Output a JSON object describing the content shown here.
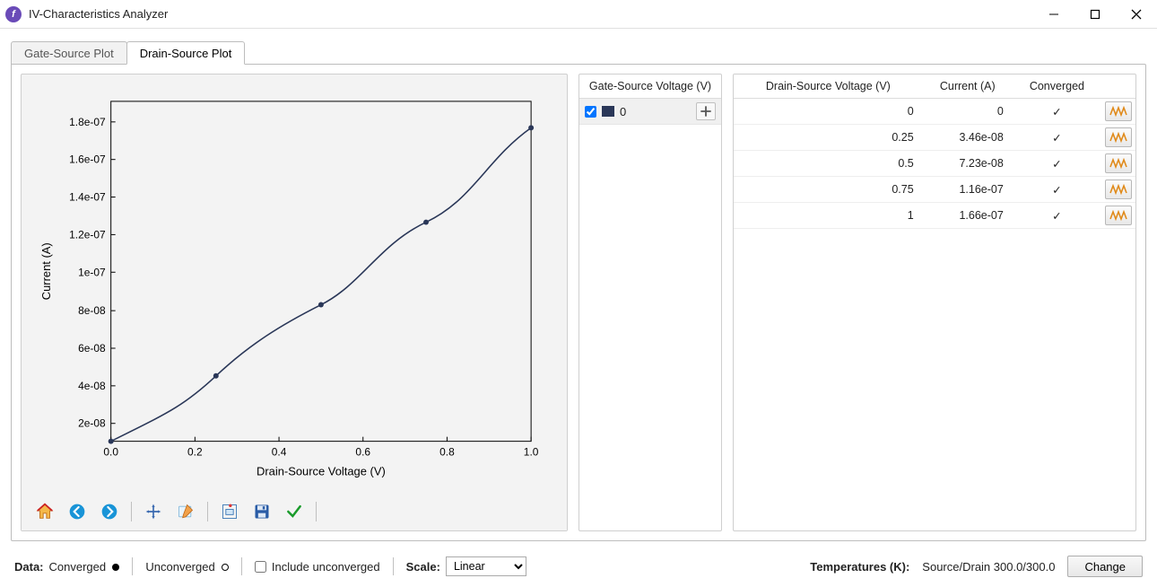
{
  "window": {
    "title": "IV-Characteristics Analyzer"
  },
  "tabs": [
    {
      "label": "Gate-Source Plot",
      "active": false
    },
    {
      "label": "Drain-Source Plot",
      "active": true
    }
  ],
  "chart_data": {
    "type": "line",
    "x": [
      0.0,
      0.25,
      0.5,
      0.75,
      1.0
    ],
    "y": [
      0,
      3.46e-08,
      7.23e-08,
      1.16e-07,
      1.66e-07
    ],
    "xlabel": "Drain-Source Voltage (V)",
    "ylabel": "Current (A)",
    "xticks": [
      "0.0",
      "0.2",
      "0.4",
      "0.6",
      "0.8",
      "1.0"
    ],
    "yticks": [
      "2e-08",
      "4e-08",
      "6e-08",
      "8e-08",
      "1e-07",
      "1.2e-07",
      "1.4e-07",
      "1.6e-07",
      "1.8e-07"
    ],
    "xlim": [
      0.0,
      1.0
    ],
    "ylim": [
      0,
      1.8e-07
    ],
    "series_name": "0",
    "series_color": "#2a3758"
  },
  "legend": {
    "header": "Gate-Source Voltage (V)",
    "items": [
      {
        "checked": true,
        "color": "#2a3758",
        "label": "0"
      }
    ]
  },
  "table": {
    "columns": [
      "Drain-Source Voltage (V)",
      "Current (A)",
      "Converged"
    ],
    "rows": [
      {
        "voltage": "0",
        "current": "0",
        "converged": "✓"
      },
      {
        "voltage": "0.25",
        "current": "3.46e-08",
        "converged": "✓"
      },
      {
        "voltage": "0.5",
        "current": "7.23e-08",
        "converged": "✓"
      },
      {
        "voltage": "0.75",
        "current": "1.16e-07",
        "converged": "✓"
      },
      {
        "voltage": "1",
        "current": "1.66e-07",
        "converged": "✓"
      }
    ]
  },
  "bottombar": {
    "data_label": "Data:",
    "converged_label": "Converged",
    "unconverged_label": "Unconverged",
    "include_unconverged_label": "Include unconverged",
    "include_unconverged_checked": false,
    "scale_label": "Scale:",
    "scale_options": [
      "Linear"
    ],
    "scale_value": "Linear",
    "temperatures_label": "Temperatures (K):",
    "temperatures_value": "Source/Drain  300.0/300.0",
    "change_button": "Change"
  },
  "toolbar_names": {
    "home": "home-icon",
    "back": "back-icon",
    "forward": "forward-icon",
    "pan": "pan-icon",
    "edit": "edit-icon",
    "zoom": "zoom-icon",
    "save": "save-icon",
    "apply": "apply-icon"
  }
}
